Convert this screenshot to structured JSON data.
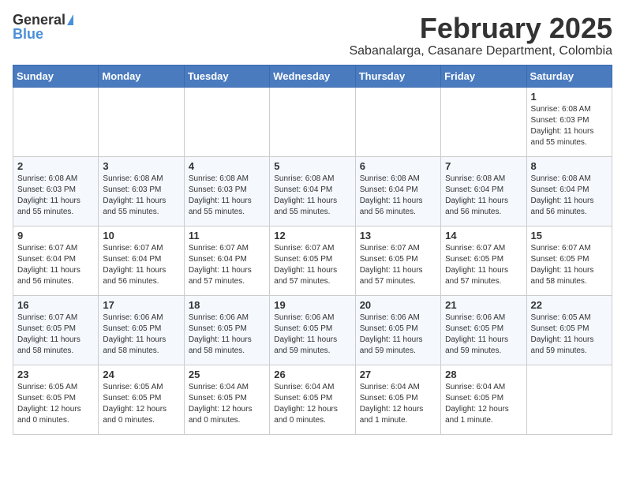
{
  "header": {
    "logo_general": "General",
    "logo_blue": "Blue",
    "month_year": "February 2025",
    "location": "Sabanalarga, Casanare Department, Colombia"
  },
  "weekdays": [
    "Sunday",
    "Monday",
    "Tuesday",
    "Wednesday",
    "Thursday",
    "Friday",
    "Saturday"
  ],
  "weeks": [
    [
      {
        "day": "",
        "info": ""
      },
      {
        "day": "",
        "info": ""
      },
      {
        "day": "",
        "info": ""
      },
      {
        "day": "",
        "info": ""
      },
      {
        "day": "",
        "info": ""
      },
      {
        "day": "",
        "info": ""
      },
      {
        "day": "1",
        "info": "Sunrise: 6:08 AM\nSunset: 6:03 PM\nDaylight: 11 hours and 55 minutes."
      }
    ],
    [
      {
        "day": "2",
        "info": "Sunrise: 6:08 AM\nSunset: 6:03 PM\nDaylight: 11 hours and 55 minutes."
      },
      {
        "day": "3",
        "info": "Sunrise: 6:08 AM\nSunset: 6:03 PM\nDaylight: 11 hours and 55 minutes."
      },
      {
        "day": "4",
        "info": "Sunrise: 6:08 AM\nSunset: 6:03 PM\nDaylight: 11 hours and 55 minutes."
      },
      {
        "day": "5",
        "info": "Sunrise: 6:08 AM\nSunset: 6:04 PM\nDaylight: 11 hours and 55 minutes."
      },
      {
        "day": "6",
        "info": "Sunrise: 6:08 AM\nSunset: 6:04 PM\nDaylight: 11 hours and 56 minutes."
      },
      {
        "day": "7",
        "info": "Sunrise: 6:08 AM\nSunset: 6:04 PM\nDaylight: 11 hours and 56 minutes."
      },
      {
        "day": "8",
        "info": "Sunrise: 6:08 AM\nSunset: 6:04 PM\nDaylight: 11 hours and 56 minutes."
      }
    ],
    [
      {
        "day": "9",
        "info": "Sunrise: 6:07 AM\nSunset: 6:04 PM\nDaylight: 11 hours and 56 minutes."
      },
      {
        "day": "10",
        "info": "Sunrise: 6:07 AM\nSunset: 6:04 PM\nDaylight: 11 hours and 56 minutes."
      },
      {
        "day": "11",
        "info": "Sunrise: 6:07 AM\nSunset: 6:04 PM\nDaylight: 11 hours and 57 minutes."
      },
      {
        "day": "12",
        "info": "Sunrise: 6:07 AM\nSunset: 6:05 PM\nDaylight: 11 hours and 57 minutes."
      },
      {
        "day": "13",
        "info": "Sunrise: 6:07 AM\nSunset: 6:05 PM\nDaylight: 11 hours and 57 minutes."
      },
      {
        "day": "14",
        "info": "Sunrise: 6:07 AM\nSunset: 6:05 PM\nDaylight: 11 hours and 57 minutes."
      },
      {
        "day": "15",
        "info": "Sunrise: 6:07 AM\nSunset: 6:05 PM\nDaylight: 11 hours and 58 minutes."
      }
    ],
    [
      {
        "day": "16",
        "info": "Sunrise: 6:07 AM\nSunset: 6:05 PM\nDaylight: 11 hours and 58 minutes."
      },
      {
        "day": "17",
        "info": "Sunrise: 6:06 AM\nSunset: 6:05 PM\nDaylight: 11 hours and 58 minutes."
      },
      {
        "day": "18",
        "info": "Sunrise: 6:06 AM\nSunset: 6:05 PM\nDaylight: 11 hours and 58 minutes."
      },
      {
        "day": "19",
        "info": "Sunrise: 6:06 AM\nSunset: 6:05 PM\nDaylight: 11 hours and 59 minutes."
      },
      {
        "day": "20",
        "info": "Sunrise: 6:06 AM\nSunset: 6:05 PM\nDaylight: 11 hours and 59 minutes."
      },
      {
        "day": "21",
        "info": "Sunrise: 6:06 AM\nSunset: 6:05 PM\nDaylight: 11 hours and 59 minutes."
      },
      {
        "day": "22",
        "info": "Sunrise: 6:05 AM\nSunset: 6:05 PM\nDaylight: 11 hours and 59 minutes."
      }
    ],
    [
      {
        "day": "23",
        "info": "Sunrise: 6:05 AM\nSunset: 6:05 PM\nDaylight: 12 hours and 0 minutes."
      },
      {
        "day": "24",
        "info": "Sunrise: 6:05 AM\nSunset: 6:05 PM\nDaylight: 12 hours and 0 minutes."
      },
      {
        "day": "25",
        "info": "Sunrise: 6:04 AM\nSunset: 6:05 PM\nDaylight: 12 hours and 0 minutes."
      },
      {
        "day": "26",
        "info": "Sunrise: 6:04 AM\nSunset: 6:05 PM\nDaylight: 12 hours and 0 minutes."
      },
      {
        "day": "27",
        "info": "Sunrise: 6:04 AM\nSunset: 6:05 PM\nDaylight: 12 hours and 1 minute."
      },
      {
        "day": "28",
        "info": "Sunrise: 6:04 AM\nSunset: 6:05 PM\nDaylight: 12 hours and 1 minute."
      },
      {
        "day": "",
        "info": ""
      }
    ]
  ]
}
